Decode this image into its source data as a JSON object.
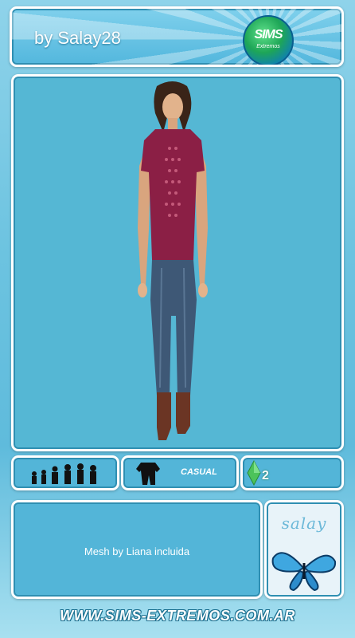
{
  "header": {
    "byline": "by Salay28",
    "logo_text": "SIMS",
    "logo_subtext": "Extremos"
  },
  "info_bar": {
    "category": "CASUAL",
    "game_badge": "2"
  },
  "description": {
    "text": "Mesh by Liana incluida"
  },
  "signature": {
    "text": "salay"
  },
  "footer": {
    "url": "WWW.SIMS-EXTREMOS.COM.AR"
  },
  "icons": {
    "age_groups": "age-groups-silhouettes-icon",
    "outfit": "outfit-category-icon",
    "plumbob": "plumbob-icon",
    "butterfly": "butterfly-icon"
  },
  "colors": {
    "panel_fill": "#53b5d8",
    "border": "#ffffff",
    "top": "#8b1f45",
    "jeans": "#3e5876",
    "boots": "#6b3524"
  }
}
